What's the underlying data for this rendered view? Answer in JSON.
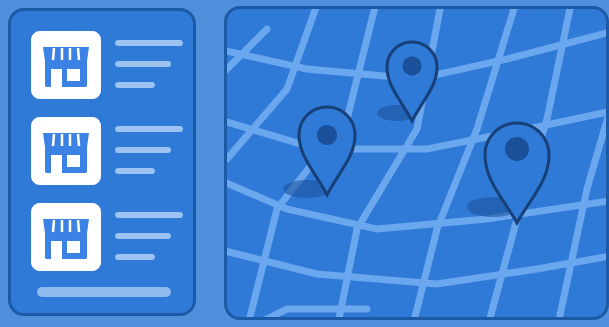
{
  "stores": [
    {
      "id": "store-1"
    },
    {
      "id": "store-2"
    },
    {
      "id": "store-3"
    }
  ],
  "map": {
    "pins": [
      {
        "id": "pin-1"
      },
      {
        "id": "pin-2"
      },
      {
        "id": "pin-3"
      }
    ]
  },
  "colors": {
    "background": "#4f8fdc",
    "panel": "#2f7ad6",
    "panel_border": "#1c5aa6",
    "road": "#6aa7ee",
    "pin": "#2f7ad6",
    "pin_stroke": "#173f78",
    "pin_dot": "#1a4f9a",
    "icon": "#3b82e4",
    "placeholder_line": "#9cc3f2"
  },
  "icons": {
    "store": "store-icon",
    "pin": "map-pin-icon"
  }
}
